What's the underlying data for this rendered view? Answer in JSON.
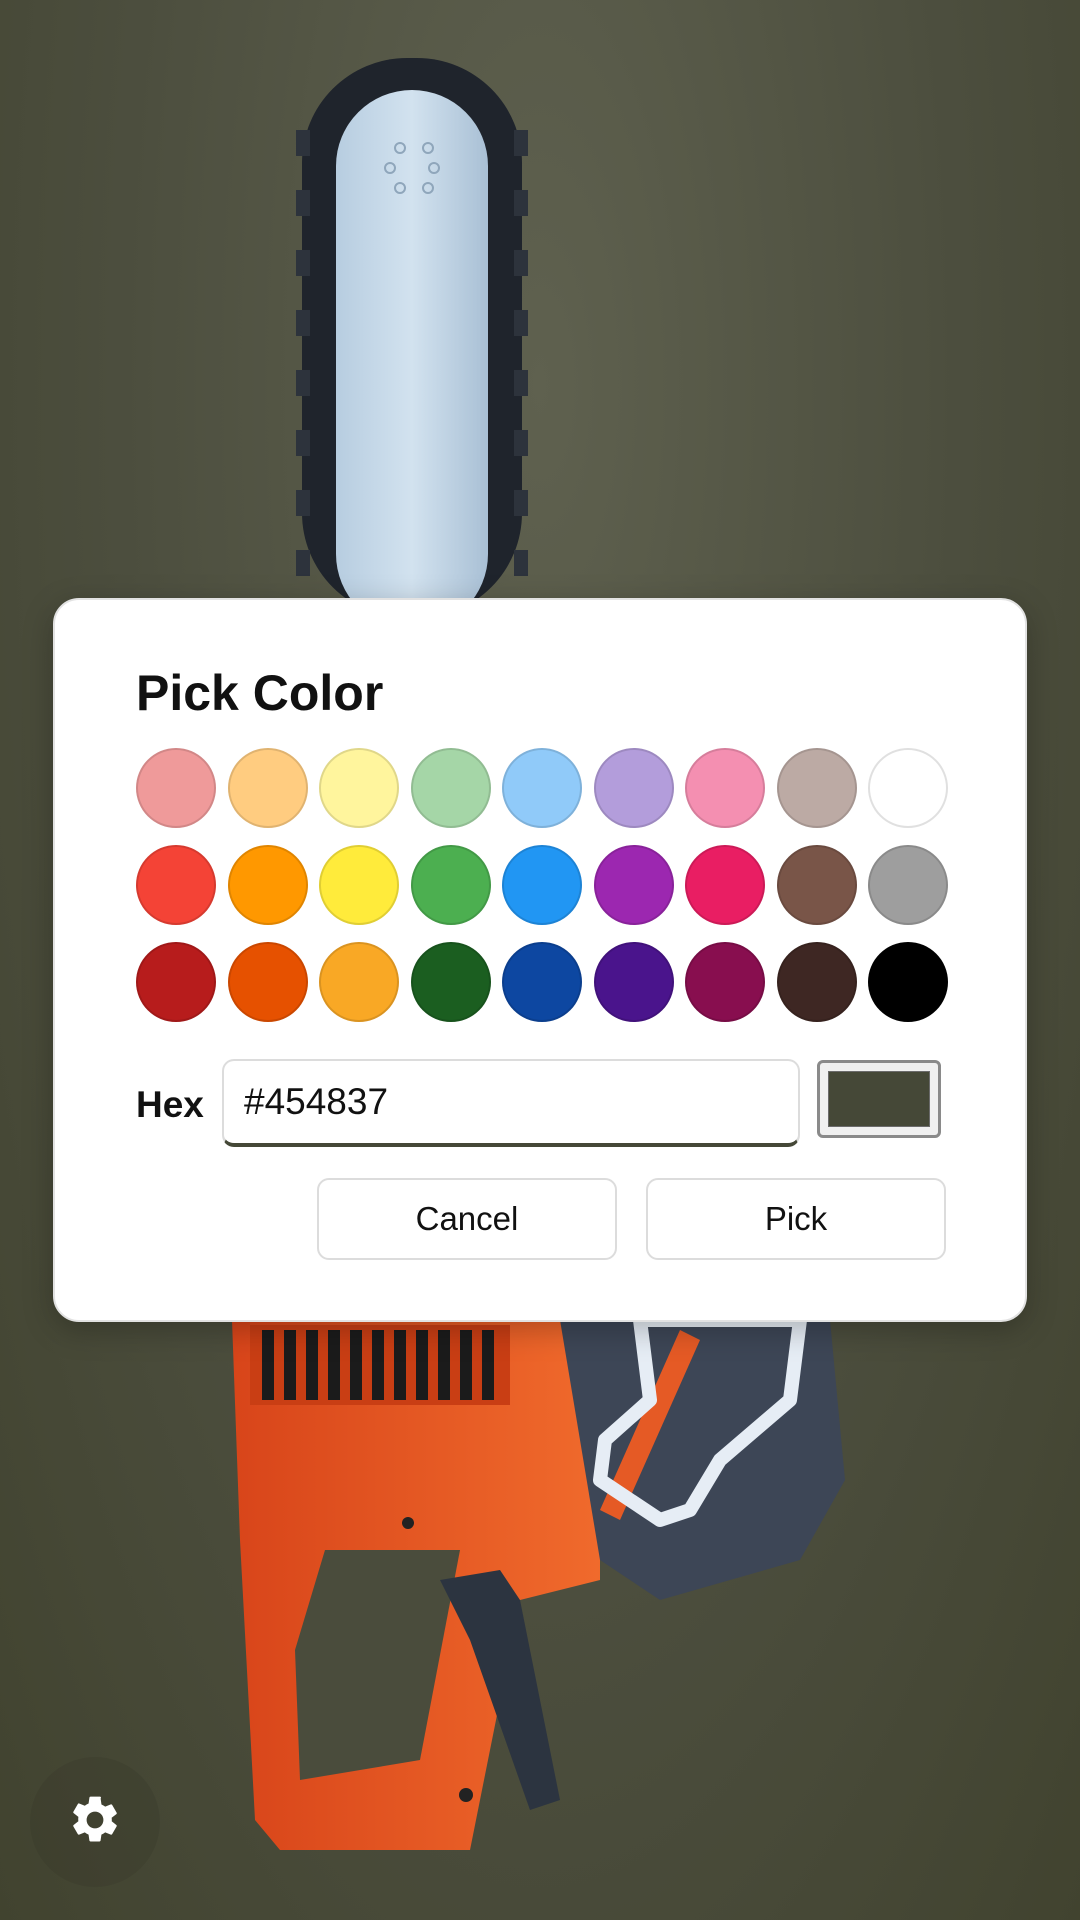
{
  "dialog": {
    "title": "Pick Color",
    "swatches": [
      [
        "#ef9a9a",
        "#ffcc80",
        "#fff59d",
        "#a5d6a7",
        "#90caf9",
        "#b39ddb",
        "#f48fb1",
        "#bcaaa4",
        "#ffffff"
      ],
      [
        "#f44336",
        "#ff9800",
        "#ffeb3b",
        "#4caf50",
        "#2196f3",
        "#9c27b0",
        "#e91e63",
        "#795548",
        "#9e9e9e"
      ],
      [
        "#b71c1c",
        "#e65100",
        "#f9a825",
        "#1b5e20",
        "#0d47a1",
        "#4a148c",
        "#880e4f",
        "#3e2723",
        "#000000"
      ]
    ],
    "hex_label": "Hex",
    "hex_value": "#454837",
    "preview_color": "#454837",
    "cancel_label": "Cancel",
    "pick_label": "Pick"
  },
  "background": {
    "color": "#4e5040",
    "scene": "chainsaw-image"
  },
  "settings": {
    "icon": "gear-icon"
  }
}
